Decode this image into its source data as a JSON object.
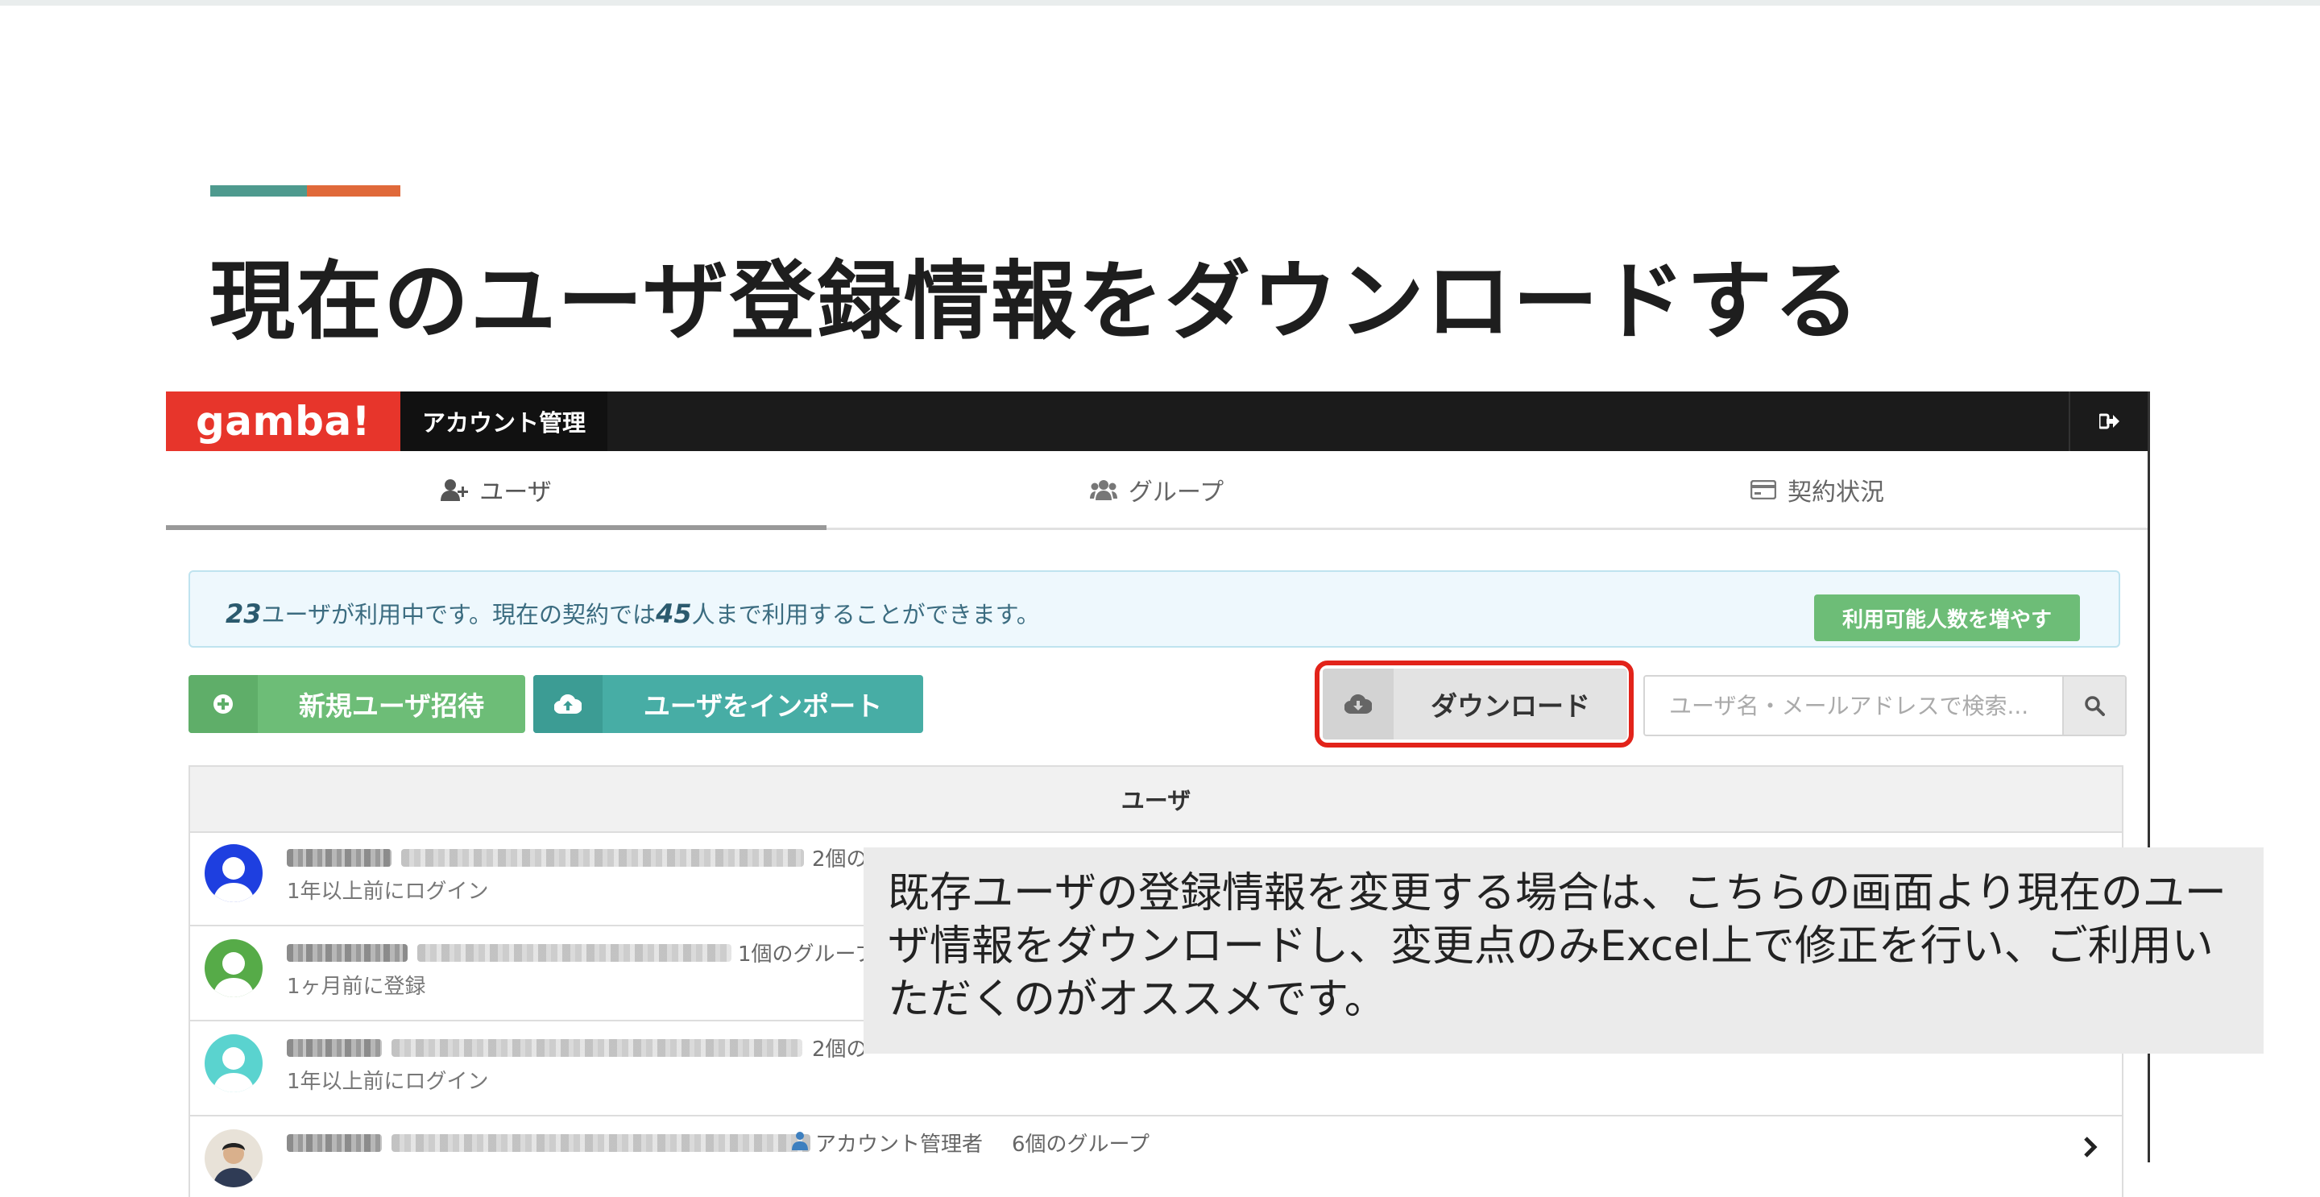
{
  "slide": {
    "title": "現在のユーザ登録情報をダウンロードする",
    "accent_colors": [
      "#4e9a8e",
      "#e0693a"
    ]
  },
  "navbar": {
    "brand": "gamba!",
    "brand_color": "#e7352b",
    "title": "アカウント管理",
    "logout_icon": "sign-out-icon"
  },
  "tabs": [
    {
      "label": "ユーザ",
      "icon": "user-plus-icon",
      "active": true
    },
    {
      "label": "グループ",
      "icon": "users-icon",
      "active": false
    },
    {
      "label": "契約状況",
      "icon": "credit-card-icon",
      "active": false
    }
  ],
  "info": {
    "users_in_use": "23",
    "text_mid": "ユーザが利用中です。現在の契約では",
    "max_users": "45",
    "text_end": "人まで利用することができます。",
    "increase_button": "利用可能人数を増やす"
  },
  "toolbar": {
    "invite_label": "新規ユーザ招待",
    "import_label": "ユーザをインポート",
    "download_label": "ダウンロード",
    "search_placeholder": "ユーザ名・メールアドレスで検索..."
  },
  "table": {
    "header": "ユーザ",
    "rows": [
      {
        "meta": "2個の",
        "sub": "1年以上前にログイン"
      },
      {
        "meta": "1個のグループ",
        "sub": "1ヶ月前に登録"
      },
      {
        "meta": "2個の",
        "sub": "1年以上前にログイン"
      },
      {
        "role": "アカウント管理者",
        "meta": "6個のグループ"
      }
    ]
  },
  "callout": {
    "text": "既存ユーザの登録情報を変更する場合は、こちらの画面より現在のユーザ情報をダウンロードし、変更点のみExcel上で修正を行い、ご利用いただくのがオススメです。"
  }
}
